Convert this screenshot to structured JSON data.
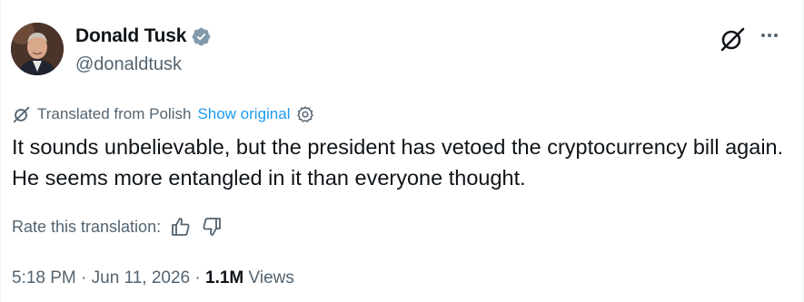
{
  "author": {
    "name": "Donald Tusk",
    "handle": "@donaldtusk",
    "verified_color": "#829aab"
  },
  "translation": {
    "label": "Translated from Polish",
    "show_original": "Show original"
  },
  "tweet": {
    "text": "It sounds unbelievable, but the president has vetoed the cryptocurrency bill again. He seems more entangled in it than everyone thought."
  },
  "rate": {
    "label": "Rate this translation:"
  },
  "meta": {
    "time": "5:18 PM",
    "separator": "·",
    "date": "Jun 11, 2026",
    "views_count": "1.1M",
    "views_label": "Views"
  },
  "icons": {
    "grok": "grok-icon",
    "more": "more-icon",
    "translate": "translate-icon",
    "settings": "gear-icon",
    "thumbs_up": "thumbs-up-icon",
    "thumbs_down": "thumbs-down-icon"
  },
  "colors": {
    "link": "#1d9bf0",
    "secondary": "#536471",
    "primary": "#0f1419"
  }
}
